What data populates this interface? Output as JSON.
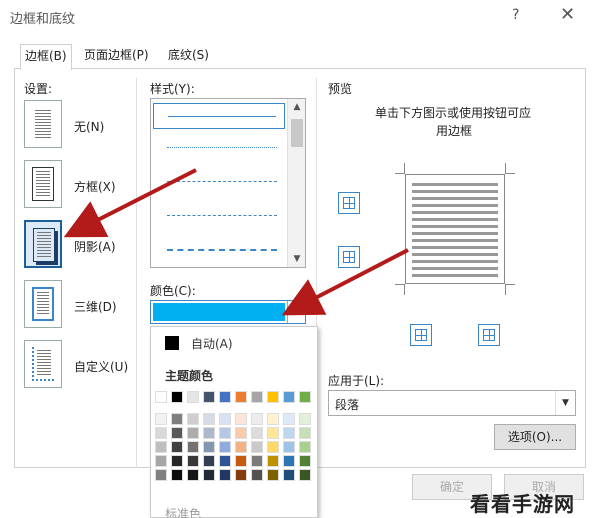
{
  "window": {
    "title": "边框和底纹",
    "help": "?",
    "close": "✕"
  },
  "tabs": [
    {
      "label": "边框(B)",
      "active": true
    },
    {
      "label": "页面边框(P)",
      "active": false
    },
    {
      "label": "底纹(S)",
      "active": false
    }
  ],
  "settings": {
    "label": "设置:",
    "items": [
      {
        "label": "无(N)",
        "icon": "setting-none-icon"
      },
      {
        "label": "方框(X)",
        "icon": "setting-box-icon"
      },
      {
        "label": "阴影(A)",
        "icon": "setting-shadow-icon",
        "selected": true
      },
      {
        "label": "三维(D)",
        "icon": "setting-3d-icon"
      },
      {
        "label": "自定义(U)",
        "icon": "setting-custom-icon"
      }
    ]
  },
  "style": {
    "label": "样式(Y):"
  },
  "color": {
    "label": "颜色(C):",
    "value": "#00b0f0"
  },
  "palette": {
    "auto_label": "自动(A)",
    "theme_label": "主题颜色",
    "standard_label": "标准色"
  },
  "preview": {
    "label": "预览",
    "instruction_line1": "单击下方图示或使用按钮可应",
    "instruction_line2": "用边框"
  },
  "apply_to": {
    "label": "应用于(L):",
    "value": "段落"
  },
  "buttons": {
    "options": "选项(O)...",
    "ok": "确定",
    "cancel": "取消"
  },
  "watermark": "看看手游网",
  "colors": {
    "accent": "#3b86c6",
    "arrow": "#b31b1b",
    "selected_color": "#00b0f0"
  }
}
